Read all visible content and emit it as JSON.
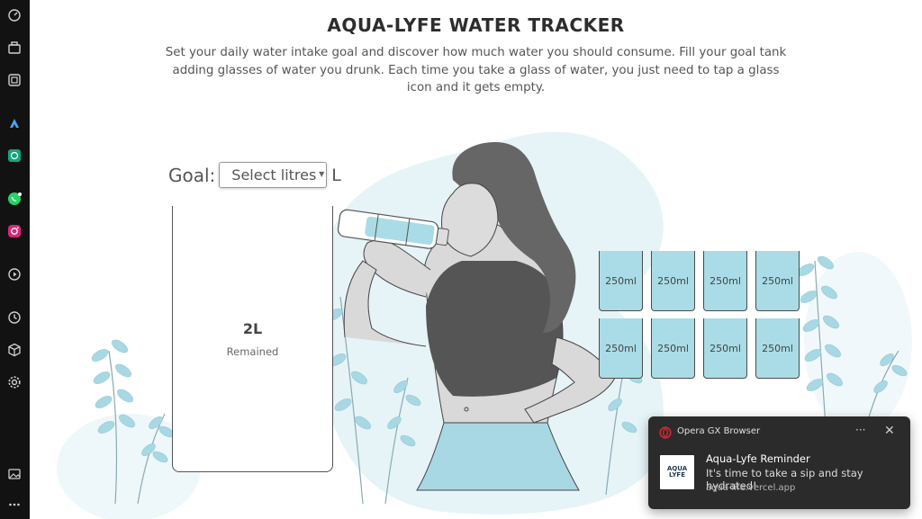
{
  "page": {
    "title": "AQUA-LYFE WATER TRACKER",
    "subtitle": "Set your daily water intake goal and discover how much water you should consume. Fill your goal tank adding glasses of water you drunk. Each time you take a glass of water, you just need to tap a glass icon and it gets empty."
  },
  "goal": {
    "label": "Goal:",
    "select_value": "Select litres",
    "unit": "L"
  },
  "tank": {
    "amount": "2L",
    "status": "Remained"
  },
  "glasses": [
    "250ml",
    "250ml",
    "250ml",
    "250ml",
    "250ml",
    "250ml",
    "250ml",
    "250ml"
  ],
  "sidebar": {
    "icons": [
      "speed-dial-icon",
      "workspace-icon",
      "gx-control-icon",
      "aria-icon",
      "chatgpt-icon",
      "whatsapp-icon",
      "instagram-icon",
      "player-icon",
      "history-icon",
      "extensions-icon",
      "settings-icon",
      "gallery-icon",
      "more-icon"
    ]
  },
  "notification": {
    "app_name": "Opera GX Browser",
    "more": "···",
    "close": "✕",
    "thumb_text": "AQUA LYFE",
    "title": "Aqua-Lyfe Reminder",
    "body": "It's time to take a sip and stay hydrated!",
    "url": "aqua-life.vercel.app"
  },
  "colors": {
    "water": "#a9dce6",
    "blob": "#e6f4f8",
    "leaf": "#a8d8e4",
    "sidebar": "#121212",
    "notification_bg": "#2b2b2b",
    "opera_red": "#e0242f"
  }
}
